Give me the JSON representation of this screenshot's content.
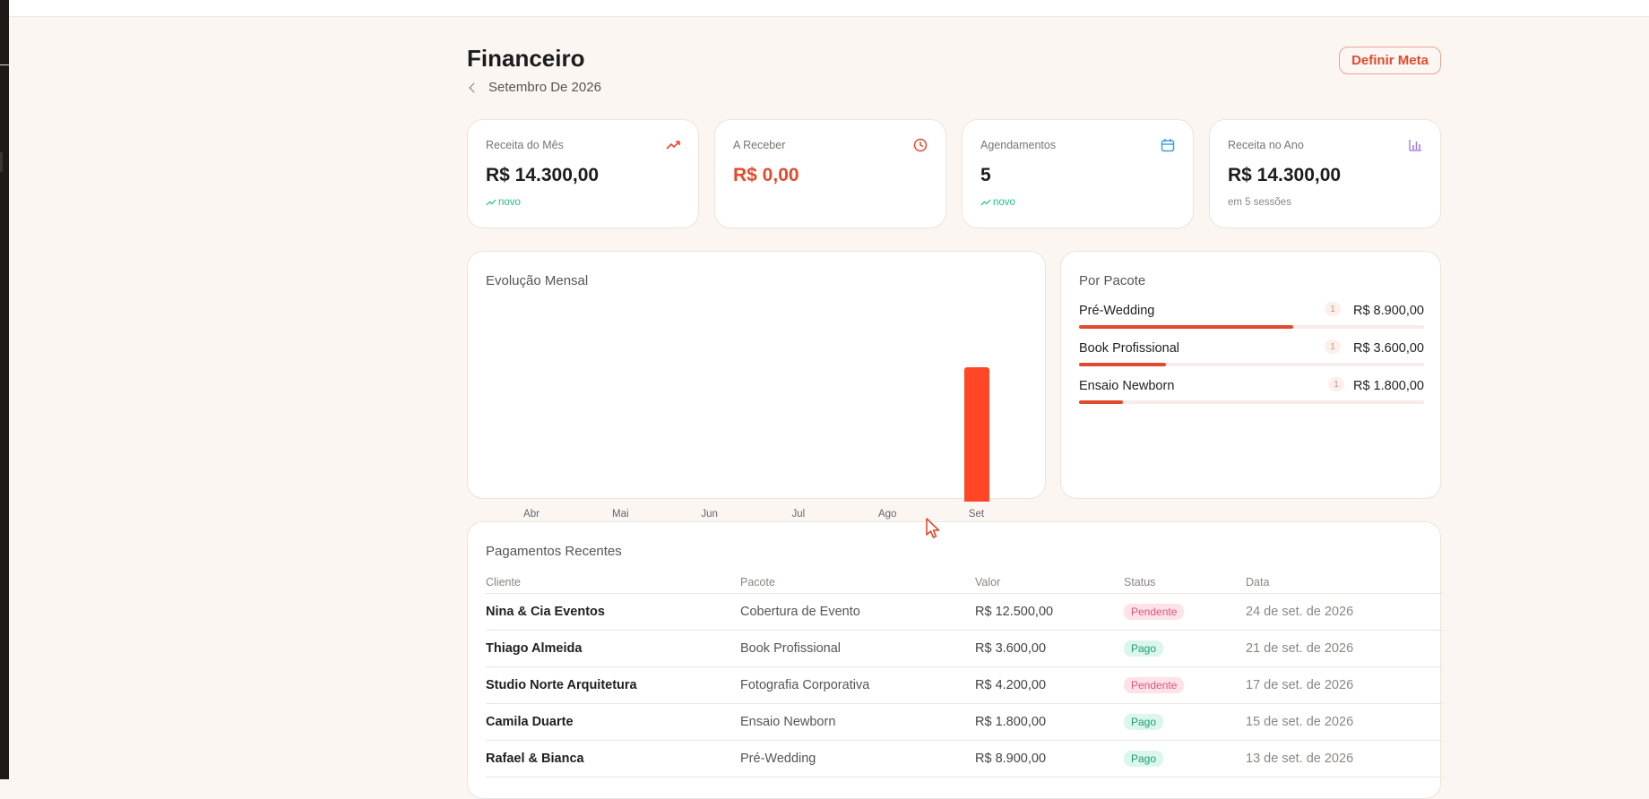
{
  "header": {
    "title": "Financeiro",
    "period": "Setembro De 2026",
    "goal_button": "Definir Meta"
  },
  "colors": {
    "accent": "#e24a2d",
    "bar": "#ff4727",
    "positive": "#22b98a",
    "pending_bg": "#fde3e8",
    "paid_bg": "#dbf6ec"
  },
  "stats": [
    {
      "label": "Receita do Mês",
      "value": "R$ 14.300,00",
      "sub": "novo",
      "icon": "trending-up-icon"
    },
    {
      "label": "A Receber",
      "value": "R$ 0,00",
      "sub": "",
      "icon": "clock-icon"
    },
    {
      "label": "Agendamentos",
      "value": "5",
      "sub": "novo",
      "icon": "calendar-icon"
    },
    {
      "label": "Receita no Ano",
      "value": "R$ 14.300,00",
      "sub": "em 5 sessões",
      "icon": "bar-chart-icon"
    }
  ],
  "monthly_chart": {
    "title": "Evolução Mensal"
  },
  "chart_data": {
    "type": "bar",
    "title": "Evolução Mensal",
    "categories": [
      "Abr",
      "Mai",
      "Jun",
      "Jul",
      "Ago",
      "Set"
    ],
    "values": [
      0,
      0,
      0,
      0,
      0,
      14300
    ],
    "ylim": [
      0,
      14300
    ],
    "grid": false
  },
  "packages": {
    "title": "Por Pacote",
    "items": [
      {
        "name": "Pré-Wedding",
        "count": "1",
        "value": "R$ 8.900,00",
        "share": 0.622
      },
      {
        "name": "Book Profissional",
        "count": "1",
        "value": "R$ 3.600,00",
        "share": 0.252
      },
      {
        "name": "Ensaio Newborn",
        "count": "1",
        "value": "R$ 1.800,00",
        "share": 0.126
      }
    ]
  },
  "payments": {
    "title": "Pagamentos Recentes",
    "columns": [
      "Cliente",
      "Pacote",
      "Valor",
      "Status",
      "Data"
    ],
    "rows": [
      {
        "client": "Nina & Cia Eventos",
        "package": "Cobertura de Evento",
        "value": "R$ 12.500,00",
        "status": "Pendente",
        "date": "24 de set. de 2026"
      },
      {
        "client": "Thiago Almeida",
        "package": "Book Profissional",
        "value": "R$ 3.600,00",
        "status": "Pago",
        "date": "21 de set. de 2026"
      },
      {
        "client": "Studio Norte Arquitetura",
        "package": "Fotografia Corporativa",
        "value": "R$ 4.200,00",
        "status": "Pendente",
        "date": "17 de set. de 2026"
      },
      {
        "client": "Camila Duarte",
        "package": "Ensaio Newborn",
        "value": "R$ 1.800,00",
        "status": "Pago",
        "date": "15 de set. de 2026"
      },
      {
        "client": "Rafael & Bianca",
        "package": "Pré-Wedding",
        "value": "R$ 8.900,00",
        "status": "Pago",
        "date": "13 de set. de 2026"
      }
    ]
  }
}
